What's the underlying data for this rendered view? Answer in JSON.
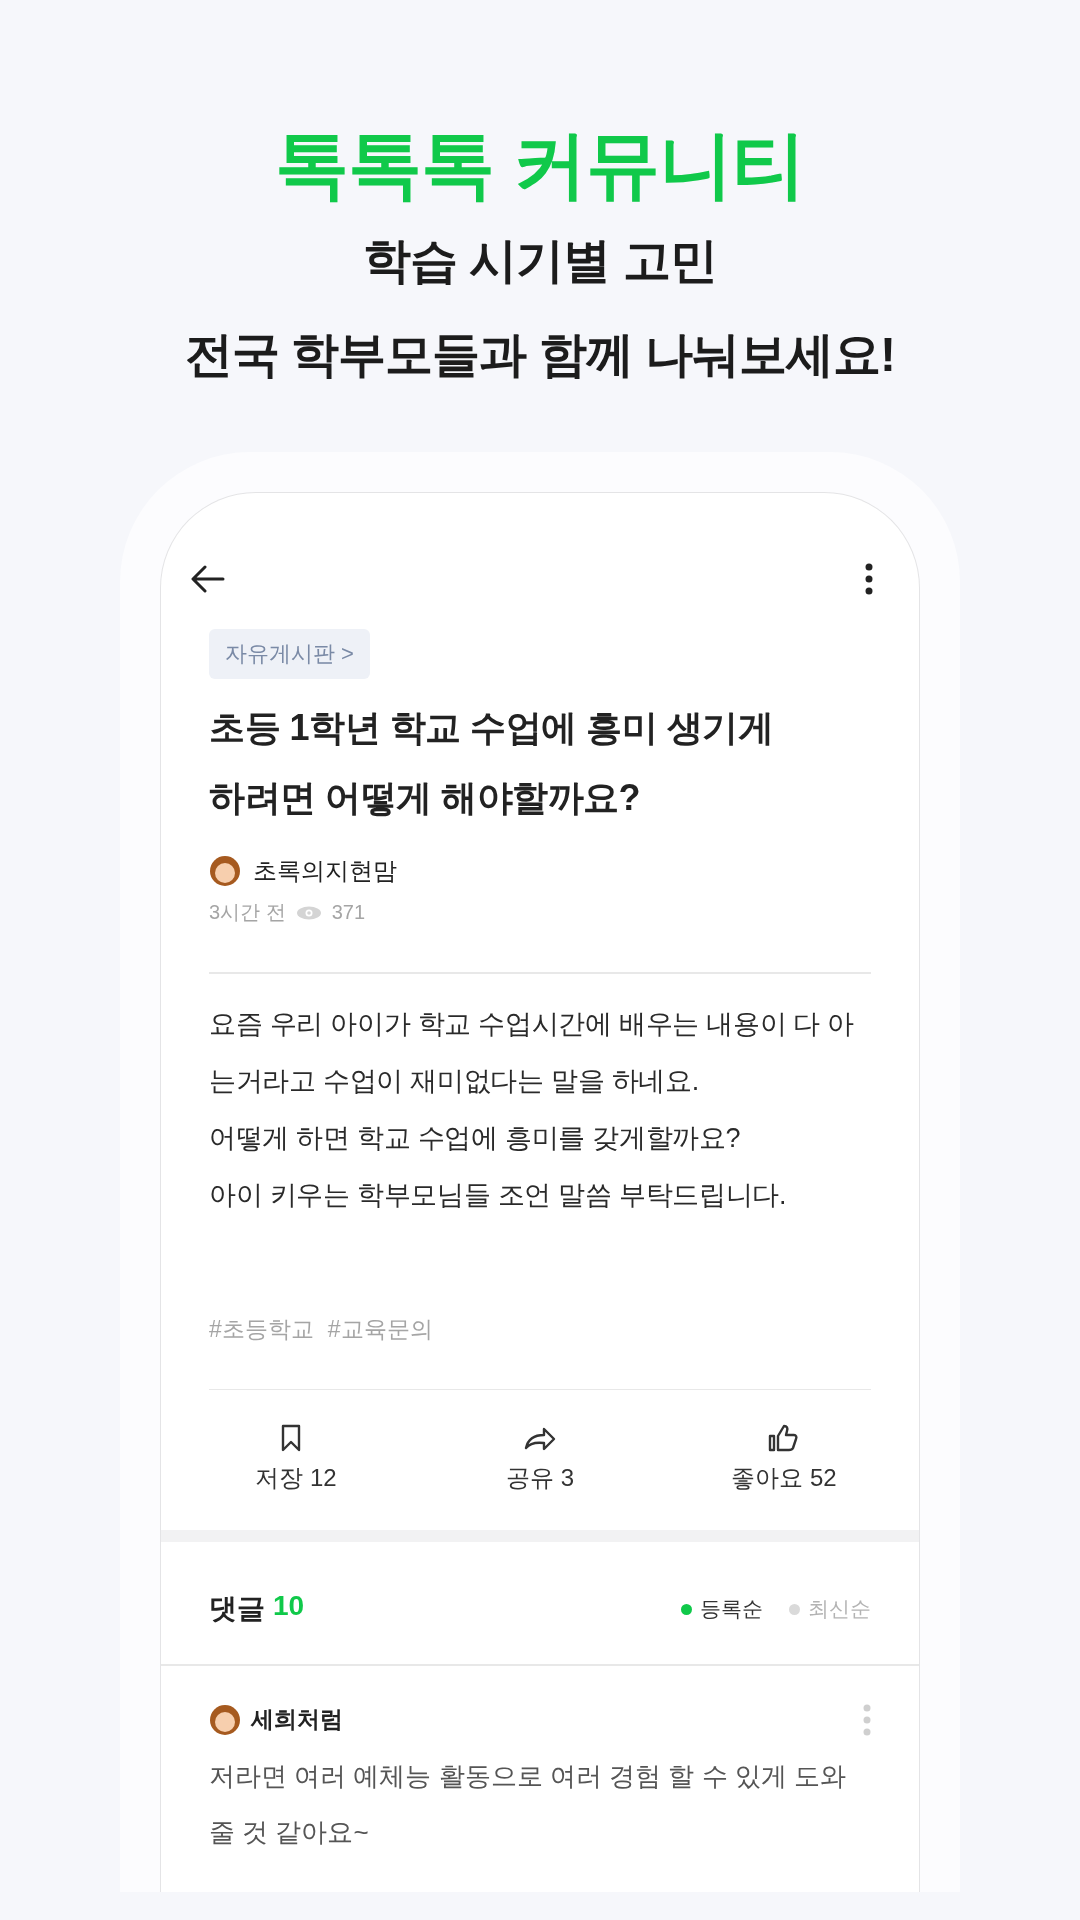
{
  "promo": {
    "headline": "톡톡톡 커뮤니티",
    "subtitle": [
      "학습 시기별 고민",
      "전국 학부모들과 함께 나눠보세요!"
    ]
  },
  "post": {
    "category": "자유게시판 >",
    "title": "초등 1학년 학교 수업에 흥미 생기게 하려면 어떻게 해야할까요?",
    "author": "초록의지현맘",
    "time": "3시간 전",
    "views": "371",
    "body": [
      "요즘 우리 아이가 학교 수업시간에 배우는 내용이 다 아는거라고 수업이 재미없다는 말을 하네요.",
      "어떻게 하면 학교 수업에 흥미를 갖게할까요?",
      "아이 키우는 학부모님들 조언 말씀 부탁드립니다."
    ],
    "tags": [
      "#초등학교",
      "#교육문의"
    ],
    "actions": [
      {
        "kind": "bookmark",
        "label": "저장 12"
      },
      {
        "kind": "share",
        "label": "공유 3"
      },
      {
        "kind": "like",
        "label": "좋아요 52"
      }
    ]
  },
  "comments": {
    "title": "댓글",
    "count": "10",
    "sort": [
      {
        "label": "등록순",
        "selected": true
      },
      {
        "label": "최신순",
        "selected": false
      }
    ],
    "items": [
      {
        "author": "세희처럼",
        "text": "저라면 여러 예체능 활동으로 여러 경험 할 수 있게 도와줄 것 같아요~"
      }
    ]
  }
}
